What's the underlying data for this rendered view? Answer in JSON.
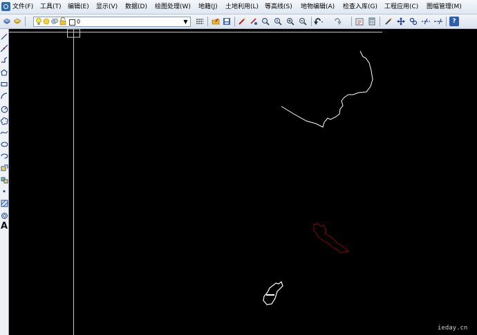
{
  "menu": [
    {
      "label": "文件(F)"
    },
    {
      "label": "工具(T)"
    },
    {
      "label": "编辑(E)"
    },
    {
      "label": "显示(V)"
    },
    {
      "label": "数据(D)"
    },
    {
      "label": "绘图处理(W)"
    },
    {
      "label": "地籍(J)"
    },
    {
      "label": "土地利用(L)"
    },
    {
      "label": "等高线(S)"
    },
    {
      "label": "地物编辑(A)"
    },
    {
      "label": "检查入库(G)"
    },
    {
      "label": "工程应用(C)"
    },
    {
      "label": "图幅管理(M)"
    }
  ],
  "toolbar": {
    "layer_name": "0",
    "icons": [
      "layers-icon",
      "layer-states-icon",
      "lightbulb-icon",
      "sun-icon",
      "freeze-icon",
      "lock-icon",
      "linetype-icon",
      "open-icon",
      "save-icon",
      "edit-pen-icon",
      "point-icon",
      "zoom-window-icon",
      "zoom-realtime-icon",
      "zoom-in-icon",
      "zoom-out-icon",
      "undo-icon",
      "redo-icon",
      "properties-icon",
      "calculator-icon",
      "pencil-icon",
      "pan-icon",
      "link-icon",
      "dash-line-icon",
      "measure-icon",
      "help-icon"
    ],
    "help_label": "?"
  },
  "left_toolbar": {
    "icons": [
      "line-icon",
      "xline-icon",
      "polyline-icon",
      "polygon-icon",
      "rectangle-icon",
      "arc-icon",
      "circle-icon",
      "revcloud-icon",
      "spline-icon",
      "ellipse-icon",
      "ellipse-arc-icon",
      "insert-block-icon",
      "make-block-icon",
      "point-icon",
      "hatch-icon",
      "region-icon",
      "mtext-icon"
    ],
    "text_tool_label": "A"
  },
  "colors": {
    "canvas": "#000000",
    "contour_line": "#ffffff",
    "red_parcel": "#d40000",
    "crosshair": "#c8c8c8"
  },
  "watermark": "ieday.cn"
}
